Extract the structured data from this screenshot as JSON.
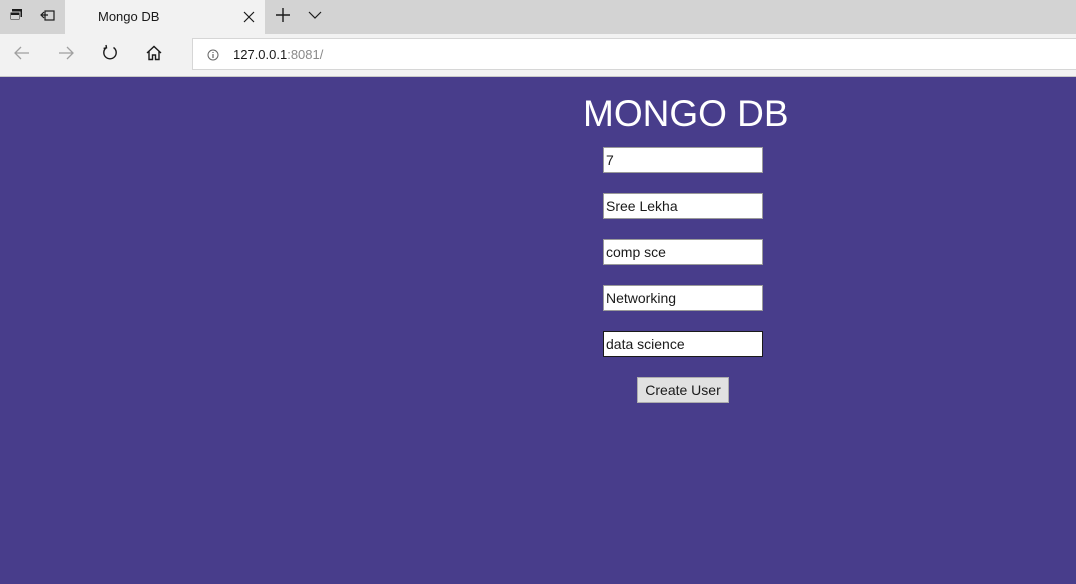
{
  "browser": {
    "tab": {
      "title": "Mongo DB"
    },
    "address": {
      "host": "127.0.0.1",
      "rest": ":8081/"
    }
  },
  "page": {
    "title": "MONGO DB",
    "fields": [
      "7",
      "Sree Lekha",
      "comp sce",
      "Networking",
      "data science"
    ],
    "button_label": "Create User"
  },
  "colors": {
    "background": "#483d8b",
    "tabbar": "#d3d3d3",
    "toolbar": "#f2f2f2"
  }
}
